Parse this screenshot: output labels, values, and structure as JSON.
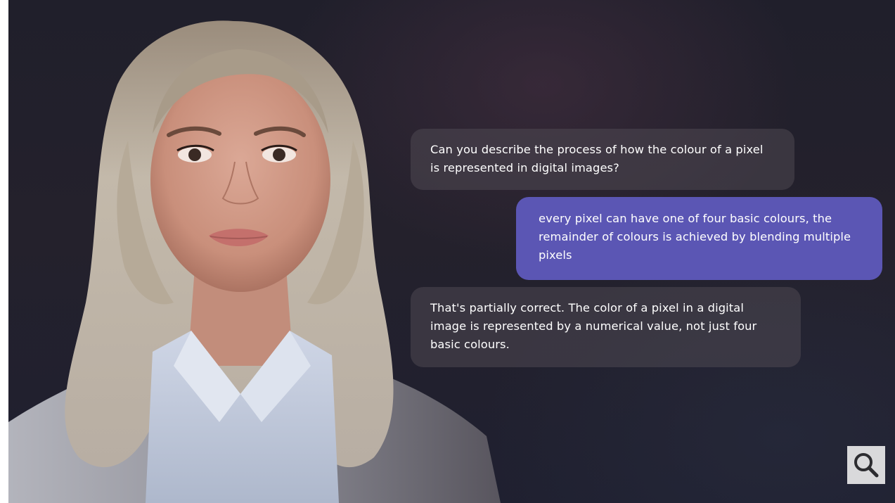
{
  "chat": {
    "messages": [
      {
        "role": "assistant",
        "text": "Can you describe the process of how the colour of a pixel is represented in digital images?"
      },
      {
        "role": "user",
        "text": "every pixel can have one of four basic colours, the remainder of colours is achieved by blending multiple pixels"
      },
      {
        "role": "assistant",
        "text": "That's partially correct. The color of a pixel in a digital image is represented by a numerical value, not just four basic colours."
      }
    ],
    "assistant_bubble_color": "#4e4852",
    "user_bubble_color": "#5b56b4"
  },
  "controls": {
    "zoom_icon": "search-icon"
  },
  "theme": {
    "background": "#221f2b"
  }
}
